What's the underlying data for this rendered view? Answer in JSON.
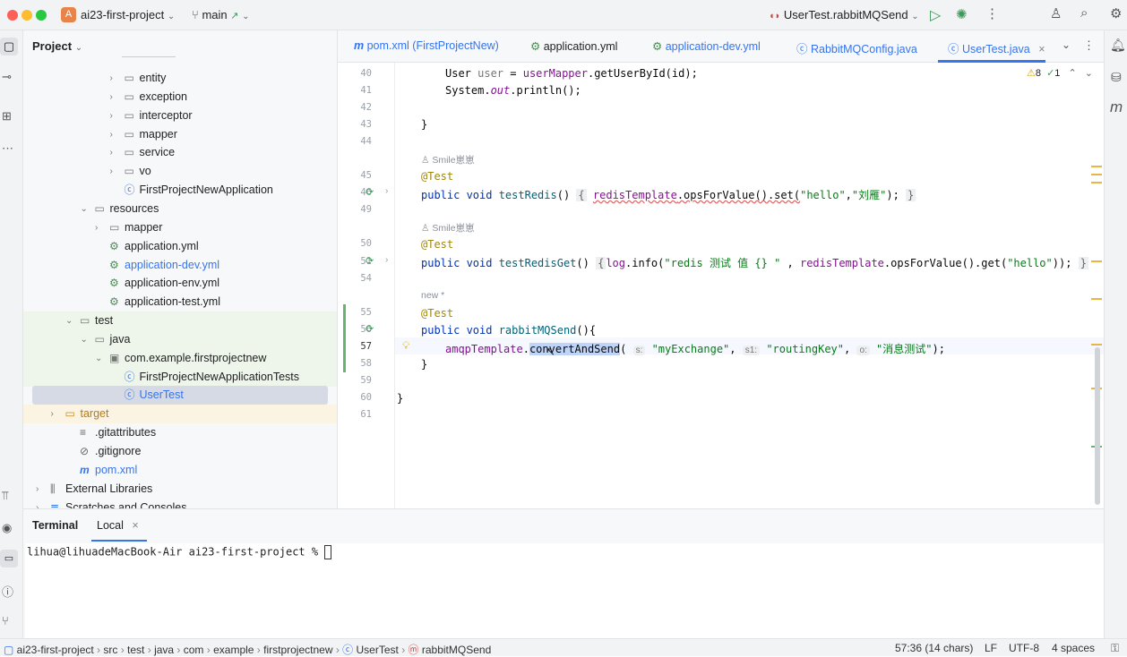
{
  "titlebar": {
    "project_initial": "A",
    "project_name": "ai23-first-project",
    "branch": "main",
    "branch_arrow": "↗",
    "run_config": "UserTest.rabbitMQSend"
  },
  "project_panel": {
    "title": "Project",
    "tree": [
      {
        "label": "entity",
        "type": "folder",
        "depth": 5
      },
      {
        "label": "exception",
        "type": "folder",
        "depth": 5
      },
      {
        "label": "interceptor",
        "type": "folder",
        "depth": 5
      },
      {
        "label": "mapper",
        "type": "folder",
        "depth": 5
      },
      {
        "label": "service",
        "type": "folder",
        "depth": 5
      },
      {
        "label": "vo",
        "type": "folder",
        "depth": 5
      },
      {
        "label": "FirstProjectNewApplication",
        "type": "class",
        "depth": 5
      },
      {
        "label": "resources",
        "type": "folder-open",
        "depth": 3
      },
      {
        "label": "mapper",
        "type": "folder",
        "depth": 4
      },
      {
        "label": "application.yml",
        "type": "yml",
        "depth": 4
      },
      {
        "label": "application-dev.yml",
        "type": "yml-mod",
        "depth": 4
      },
      {
        "label": "application-env.yml",
        "type": "yml",
        "depth": 4
      },
      {
        "label": "application-test.yml",
        "type": "yml",
        "depth": 4
      },
      {
        "label": "test",
        "type": "folder-open",
        "depth": 2
      },
      {
        "label": "java",
        "type": "folder-open",
        "depth": 3
      },
      {
        "label": "com.example.firstprojectnew",
        "type": "pkg-open",
        "depth": 4
      },
      {
        "label": "FirstProjectNewApplicationTests",
        "type": "class",
        "depth": 5
      },
      {
        "label": "UserTest",
        "type": "class-selected",
        "depth": 5
      },
      {
        "label": "target",
        "type": "folder-excluded",
        "depth": 1
      },
      {
        "label": ".gitattributes",
        "type": "file",
        "depth": 2
      },
      {
        "label": ".gitignore",
        "type": "ignore",
        "depth": 2
      },
      {
        "label": "pom.xml",
        "type": "maven",
        "depth": 2
      },
      {
        "label": "External Libraries",
        "type": "lib",
        "depth": 0
      },
      {
        "label": "Scratches and Consoles",
        "type": "scratch",
        "depth": 0
      }
    ]
  },
  "tabs": [
    {
      "label": "pom.xml (FirstProjectNew)",
      "icon": "maven-icon"
    },
    {
      "label": "application.yml",
      "icon": "yml-icon"
    },
    {
      "label": "application-dev.yml",
      "icon": "yml-icon"
    },
    {
      "label": "RabbitMQConfig.java",
      "icon": "class-icon"
    },
    {
      "label": "UserTest.java",
      "icon": "class-icon",
      "active": true
    }
  ],
  "inspections": {
    "warnings": "8",
    "ok": "1"
  },
  "editor": {
    "lines": {
      "l40": "40",
      "l41": "41",
      "l42": "42",
      "l43": "43",
      "l44": "44",
      "l45": "45",
      "l46": "46",
      "l49": "49",
      "l50": "50",
      "l51": "51",
      "l54": "54",
      "l55": "55",
      "l56": "56",
      "l57": "57",
      "l58": "58",
      "l59": "59",
      "l60": "60",
      "l61": "61"
    },
    "author1": "Smile崽崽",
    "author2": "Smile崽崽",
    "author3": "new *",
    "code": {
      "c40_a": "User ",
      "c40_b": "user",
      "c40_c": " = ",
      "c40_d": "userMapper",
      "c40_e": ".getUserById(id);",
      "c41_a": "System.",
      "c41_b": "out",
      "c41_c": ".println();",
      "c43": "}",
      "ann": "@Test",
      "c46_kw": "public void ",
      "c46_fn": "testRedis",
      "c46_rest1": "() ",
      "c46_brace": "{",
      "c46_fld": "redisTemplate",
      "c46_rest2": ".opsForValue().set(",
      "c46_s1": "\"hello\"",
      "c46_comma": ",",
      "c46_s2": "\"刘雁\"",
      "c46_end": ");",
      "c46_close": "}",
      "c51_fn": "testRedisGet",
      "c51_rest1": "() ",
      "c51_log": "log",
      "c51_rest2": ".info(",
      "c51_s1": "\"redis 测试 值 {} \"",
      "c51_rest3": " , ",
      "c51_fld": "redisTemplate",
      "c51_rest4": ".opsForValue().get(",
      "c51_s2": "\"hello\"",
      "c51_end": "));",
      "c56_fn": "rabbitMQSend",
      "c56_rest": "(){",
      "c57_fld": "amqpTemplate",
      "c57_dot": ".",
      "c57_sel": "convertAndSend",
      "c57_paren": "(",
      "c57_h1": "s:",
      "c57_s1": "\"myExchange\"",
      "c57_c1": ", ",
      "c57_h2": "s1:",
      "c57_s2": "\"routingKey\"",
      "c57_c2": ", ",
      "c57_h3": "o:",
      "c57_s3": "\"消息测试\"",
      "c57_end": ");",
      "c58": "}",
      "c60": "}"
    }
  },
  "terminal": {
    "title": "Terminal",
    "tab": "Local",
    "prompt": "lihua@lihuadeMacBook-Air ai23-first-project % "
  },
  "statusbar": {
    "crumbs": [
      "ai23-first-project",
      "src",
      "test",
      "java",
      "com",
      "example",
      "firstprojectnew",
      "UserTest",
      "rabbitMQSend"
    ],
    "position": "57:36 (14 chars)",
    "line_sep": "LF",
    "encoding": "UTF-8",
    "indent": "4 spaces"
  },
  "colors": {
    "accent": "#3574f0",
    "selection_row": "#d5dae4",
    "modified": "#3574f0",
    "excluded_folder": "#b37a1f"
  }
}
